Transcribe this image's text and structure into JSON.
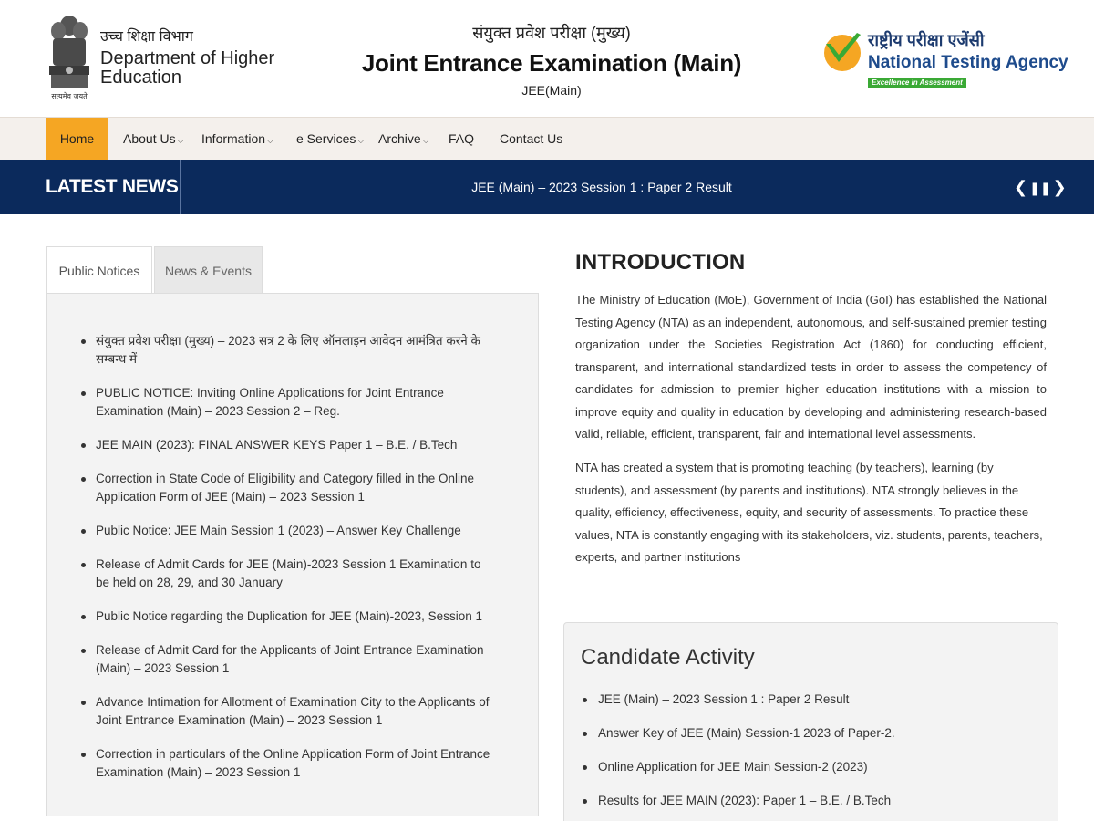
{
  "header": {
    "dept_hindi": "उच्च शिक्षा विभाग",
    "dept_english": "Department of Higher Education",
    "emblem_caption": "सत्यमेव जयते",
    "title_hindi": "संयुक्त प्रवेश परीक्षा (मुख्य)",
    "title_english": "Joint Entrance Examination (Main)",
    "subtitle": "JEE(Main)",
    "agency_hindi": "राष्ट्रीय परीक्षा एजेंसी",
    "agency_english": "National Testing Agency",
    "agency_tagline": "Excellence in Assessment"
  },
  "nav": {
    "home": "Home",
    "about": "About Us",
    "information": "Information",
    "eservices": "e Services",
    "archive": "Archive",
    "faq": "FAQ",
    "contact": "Contact Us"
  },
  "news": {
    "label": "LATEST NEWS",
    "ticker": "JEE (Main) – 2023 Session 1 : Paper 2 Result"
  },
  "tabs": {
    "public_notices": "Public Notices",
    "news_events": "News & Events"
  },
  "notices": [
    "संयुक्त प्रवेश परीक्षा (मुख्य) – 2023 सत्र 2 के लिए ऑनलाइन आवेदन आमंत्रित करने के सम्बन्ध में",
    "PUBLIC NOTICE: Inviting Online Applications for Joint Entrance Examination (Main) – 2023 Session 2 – Reg.",
    "JEE MAIN (2023): FINAL ANSWER KEYS Paper 1 – B.E. / B.Tech",
    "Correction in State Code of Eligibility and Category filled in the Online Application Form of JEE (Main) – 2023 Session 1",
    "Public Notice: JEE Main Session 1 (2023) – Answer Key Challenge",
    "Release of Admit Cards for JEE (Main)-2023 Session 1 Examination to be held on 28, 29, and 30 January",
    "Public Notice regarding the Duplication for JEE (Main)-2023, Session 1",
    "Release of Admit Card for the Applicants of Joint Entrance Examination (Main) – 2023 Session 1",
    "Advance Intimation for Allotment of Examination City to the Applicants of Joint Entrance Examination (Main) – 2023 Session 1",
    "Correction in particulars of the Online Application Form of Joint Entrance Examination (Main) – 2023 Session 1"
  ],
  "intro": {
    "title": "INTRODUCTION",
    "p1": "The Ministry of Education (MoE), Government of India (GoI) has established the National Testing Agency (NTA) as an independent, autonomous, and self-sustained premier testing organization under the Societies Registration Act (1860) for conducting efficient, transparent, and international standardized tests in order to assess the competency of candidates for admission to premier higher education institutions with a mission to improve equity and quality in education by developing and administering research-based valid, reliable, efficient, transparent, fair and international level assessments.",
    "p2": "NTA has created a system that is promoting teaching (by teachers), learning (by students), and assessment (by parents and institutions). NTA strongly believes in the quality, efficiency, effectiveness, equity, and security of assessments. To practice these values, NTA is constantly engaging with its stakeholders, viz. students, parents, teachers, experts, and partner institutions"
  },
  "activity": {
    "title": "Candidate Activity",
    "items": [
      "JEE (Main) – 2023 Session 1 : Paper 2 Result",
      "Answer Key of JEE (Main) Session-1 2023 of Paper-2.",
      "Online Application for JEE Main Session-2 (2023)",
      "Results for JEE MAIN (2023): Paper 1 – B.E. / B.Tech"
    ]
  },
  "colors": {
    "nav_active": "#f5a623",
    "news_bar": "#0b2a5c",
    "nta_blue": "#1e4b8c",
    "nta_green": "#3aa935"
  }
}
